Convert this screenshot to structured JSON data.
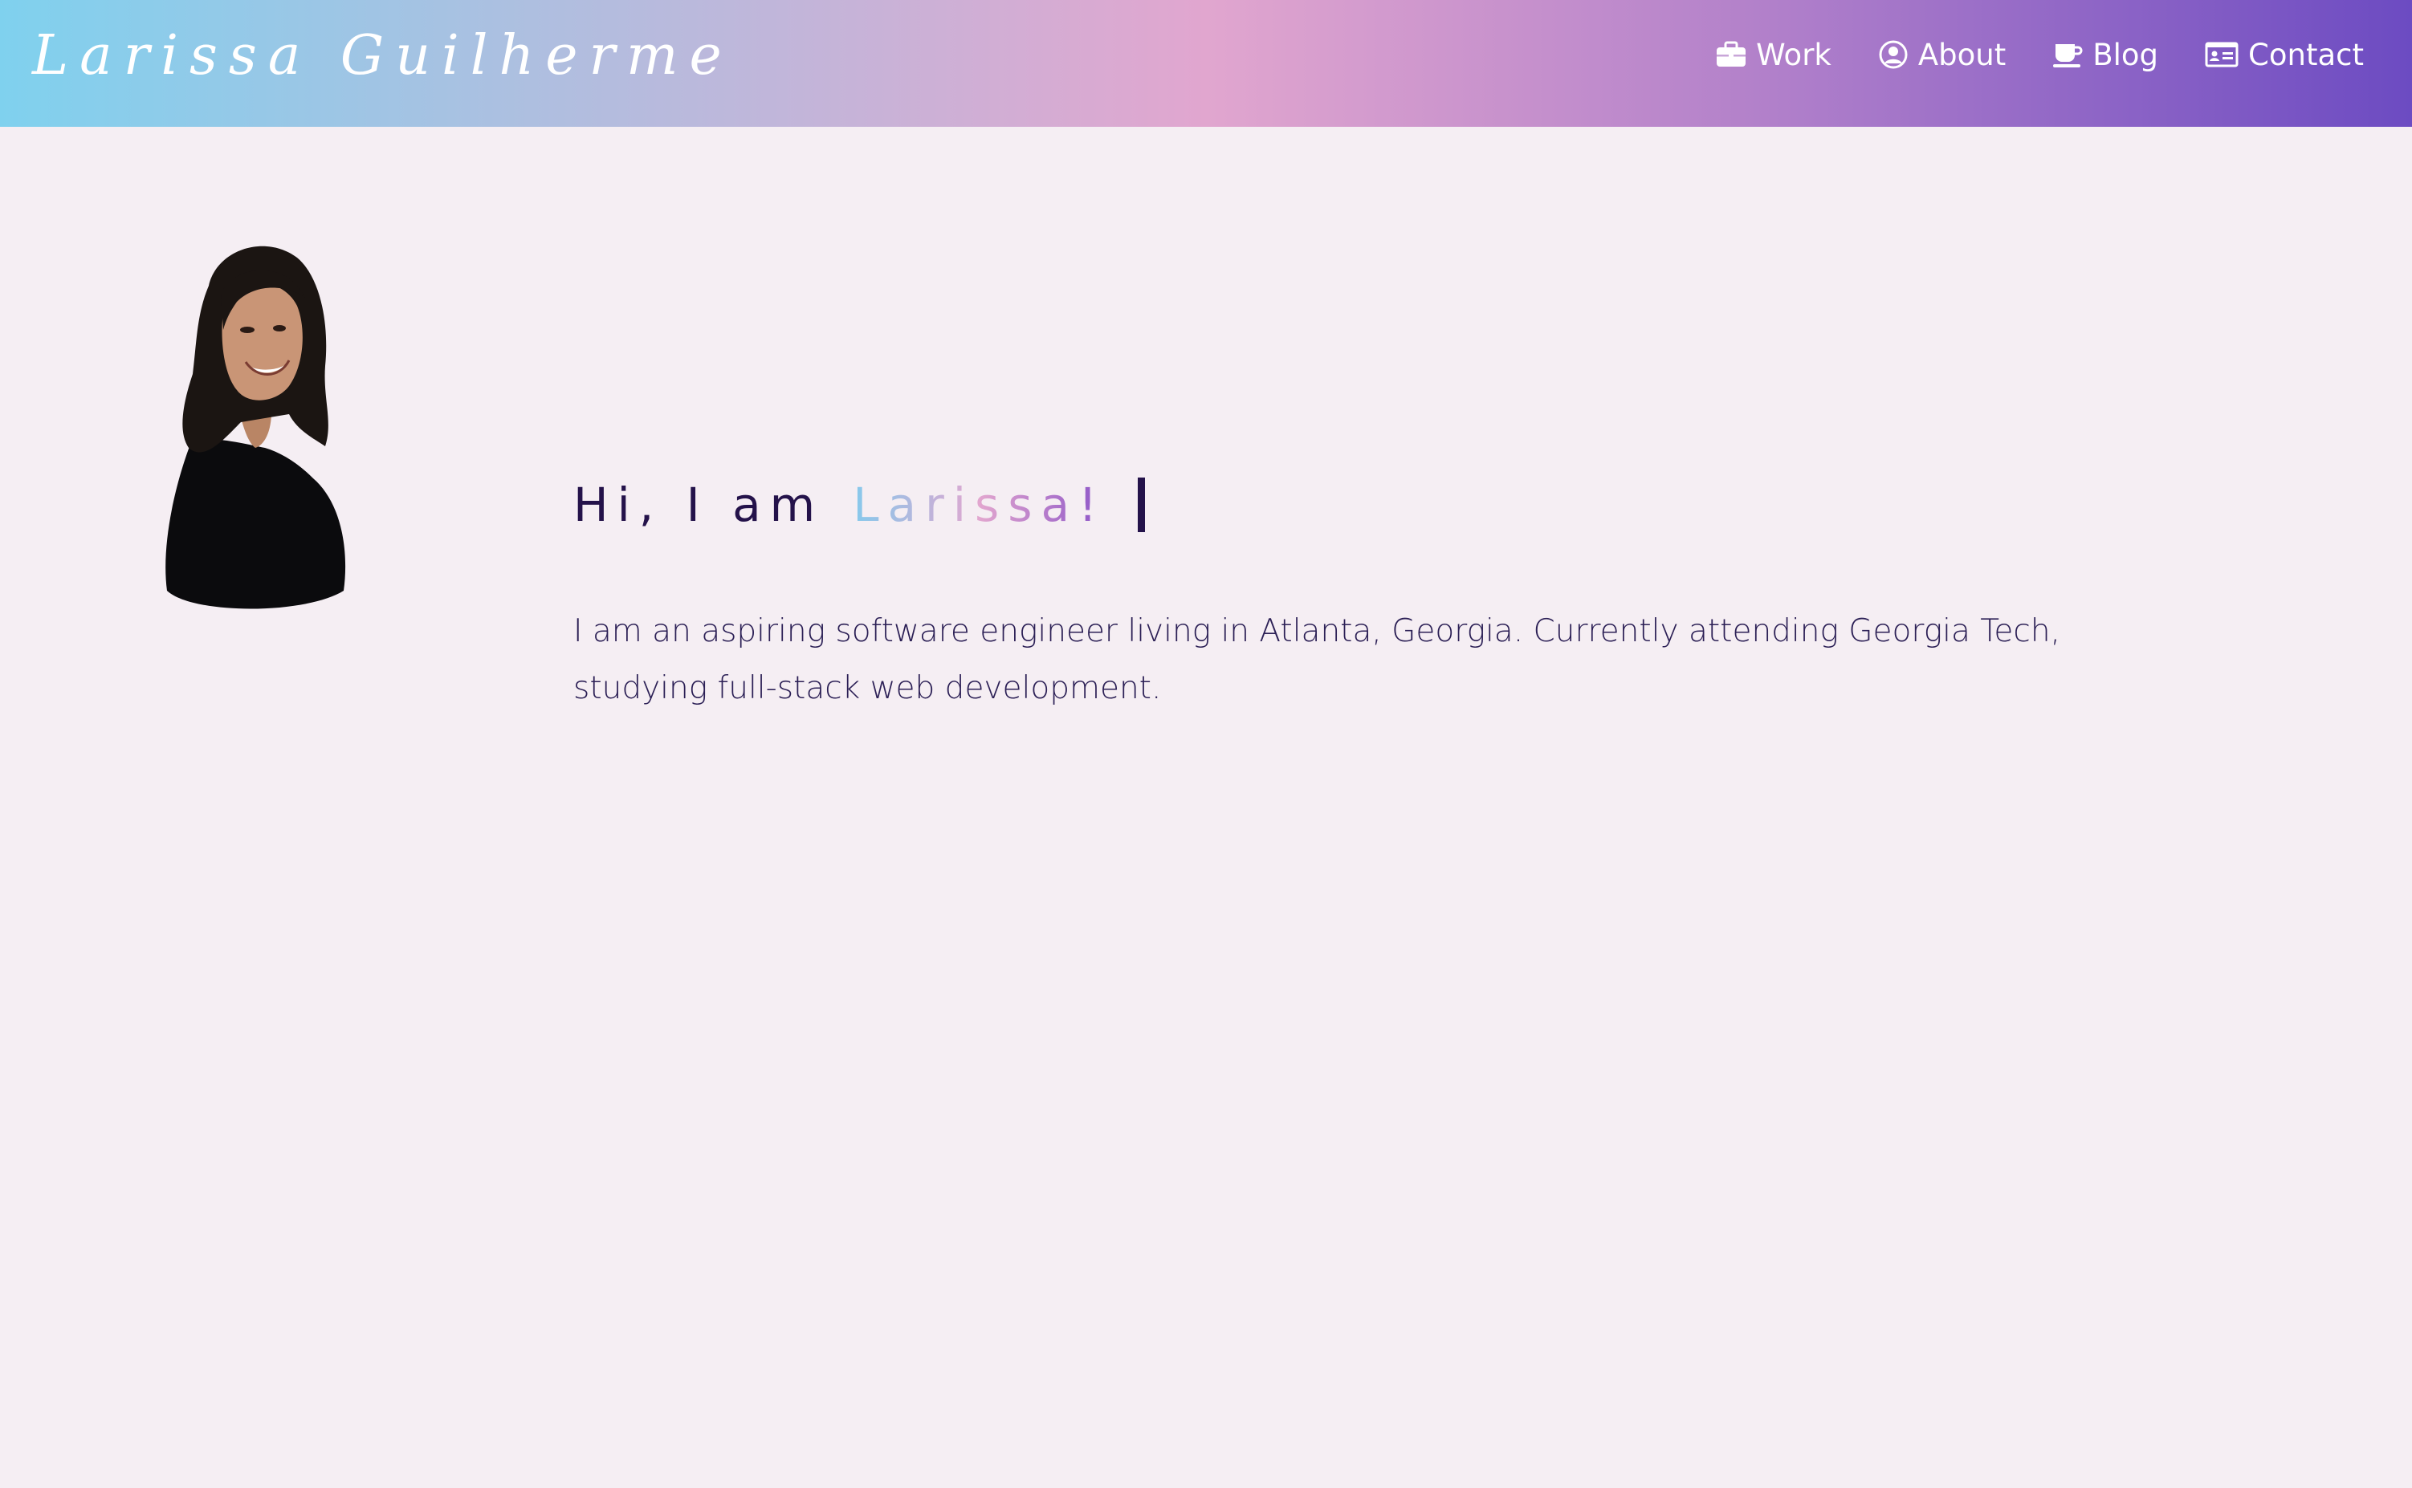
{
  "header": {
    "brand": "Larissa Guilherme",
    "nav": [
      {
        "label": "Work",
        "icon": "briefcase-icon"
      },
      {
        "label": "About",
        "icon": "user-circle-icon"
      },
      {
        "label": "Blog",
        "icon": "coffee-cup-icon"
      },
      {
        "label": "Contact",
        "icon": "id-card-icon"
      }
    ]
  },
  "hero": {
    "greeting_prefix": "Hi, I am",
    "greeting_name": "Larissa!",
    "intro": "I am an aspiring software engineer living in Atlanta, Georgia. Currently attending Georgia Tech, studying full-stack web development."
  },
  "colors": {
    "background": "#f5eef3",
    "text": "#1f1646",
    "gradient_start": "#7fd1ee",
    "gradient_mid": "#e1a6cf",
    "gradient_end": "#6c4bc2"
  }
}
